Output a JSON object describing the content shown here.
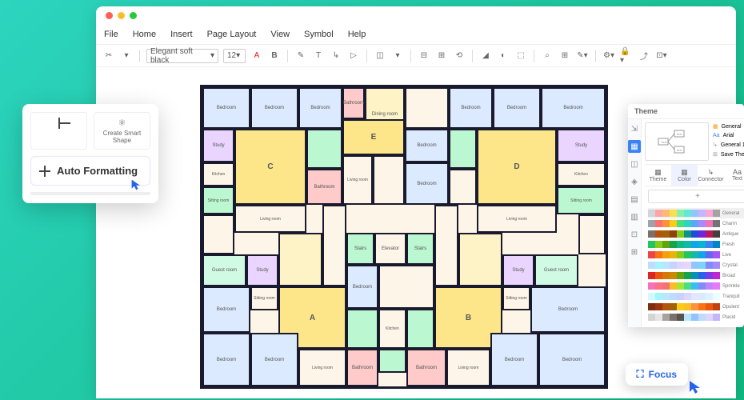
{
  "menus": [
    "File",
    "Home",
    "Insert",
    "Page Layout",
    "View",
    "Symbol",
    "Help"
  ],
  "toolbar": {
    "font": "Elegant soft black",
    "size": "12"
  },
  "autofmt": {
    "create": "Create Smart Shape",
    "main": "Auto Formatting"
  },
  "theme": {
    "title": "Theme",
    "opts": [
      "General",
      "Arial",
      "General 1",
      "Save The..."
    ],
    "tabs": [
      "Theme",
      "Color",
      "Connector",
      "Text"
    ],
    "palettes": [
      "General",
      "Charm",
      "Antique",
      "Fresh",
      "Live",
      "Crystal",
      "Broad",
      "Sprinkle",
      "Tranquil",
      "Opulent",
      "Placid"
    ]
  },
  "focus": {
    "label": "Focus"
  },
  "rooms": {
    "bedroom": "Bedroom",
    "study": "Study",
    "bath": "Bathroom",
    "dining": "Dining room",
    "living": "Living room",
    "guest": "Guest room",
    "stairs": "Stairs",
    "elevator": "Elevator",
    "kitchen": "Kitchen",
    "sitting": "Sitting room",
    "A": "A",
    "B": "B",
    "C": "C",
    "D": "D",
    "E": "E"
  },
  "paletteColors": [
    [
      "#d1d5db",
      "#fca5a5",
      "#fdba74",
      "#fde047",
      "#86efac",
      "#5eead4",
      "#93c5fd",
      "#c4b5fd",
      "#f9a8d4",
      "#a3a3a3"
    ],
    [
      "#9ca3af",
      "#f87171",
      "#fb923c",
      "#facc15",
      "#4ade80",
      "#2dd4bf",
      "#60a5fa",
      "#a78bfa",
      "#f472b6",
      "#737373"
    ],
    [
      "#78716c",
      "#b45309",
      "#a16207",
      "#92400e",
      "#84cc16",
      "#0d9488",
      "#1d4ed8",
      "#6d28d9",
      "#be185d",
      "#44403c"
    ],
    [
      "#22c55e",
      "#84cc16",
      "#65a30d",
      "#16a34a",
      "#10b981",
      "#14b8a6",
      "#0ea5e9",
      "#06b6d4",
      "#3b82f6",
      "#0284c7"
    ],
    [
      "#ef4444",
      "#f97316",
      "#f59e0b",
      "#eab308",
      "#84cc16",
      "#22c55e",
      "#14b8a6",
      "#0ea5e9",
      "#6366f1",
      "#a855f7"
    ],
    [
      "#bfdbfe",
      "#a5f3fc",
      "#bae6fd",
      "#c7d2fe",
      "#ddd6fe",
      "#e9d5ff",
      "#93c5fd",
      "#7dd3fc",
      "#818cf8",
      "#a78bfa"
    ],
    [
      "#dc2626",
      "#ea580c",
      "#d97706",
      "#ca8a04",
      "#65a30d",
      "#16a34a",
      "#0891b2",
      "#2563eb",
      "#7c3aed",
      "#c026d3"
    ],
    [
      "#f472b6",
      "#fb7185",
      "#f87171",
      "#fbbf24",
      "#a3e635",
      "#4ade80",
      "#38bdf8",
      "#818cf8",
      "#c084fc",
      "#e879f9"
    ],
    [
      "#cffafe",
      "#a5f3fc",
      "#bae6fd",
      "#bfdbfe",
      "#c7d2fe",
      "#ddd6fe",
      "#e0e7ff",
      "#dbeafe",
      "#e0f2fe",
      "#ecfeff"
    ],
    [
      "#7c2d12",
      "#9a3412",
      "#b45309",
      "#a16207",
      "#facc15",
      "#fbbf24",
      "#fb923c",
      "#f97316",
      "#ea580c",
      "#c2410c"
    ],
    [
      "#d6d3d1",
      "#e7e5e4",
      "#a8a29e",
      "#78716c",
      "#57534e",
      "#bae6fd",
      "#93c5fd",
      "#bfdbfe",
      "#ddd6fe",
      "#c4b5fd"
    ]
  ]
}
